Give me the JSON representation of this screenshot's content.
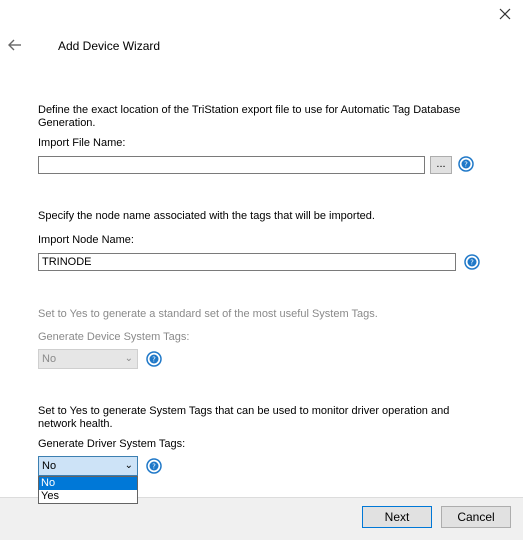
{
  "header": {
    "title": "Add Device Wizard"
  },
  "section_import_file": {
    "description": "Define the exact location of the TriStation export file to use for Automatic Tag Database Generation.",
    "label": "Import File Name:",
    "value": "",
    "browse_label": "..."
  },
  "section_node": {
    "description": "Specify the node name associated with the tags that will be imported.",
    "label": "Import Node Name:",
    "value": "TRINODE"
  },
  "section_device_tags": {
    "description": "Set to Yes to generate a standard set of the most useful System Tags.",
    "label": "Generate Device System Tags:",
    "value": "No"
  },
  "section_driver_tags": {
    "description": "Set to Yes to generate System Tags that can be used to monitor driver operation and network health.",
    "label": "Generate Driver System Tags:",
    "value": "No",
    "options": [
      "No",
      "Yes"
    ]
  },
  "footer": {
    "next_label": "Next",
    "cancel_label": "Cancel"
  },
  "colors": {
    "selected_option": "#0078d7",
    "help_icon": "#1f78c8"
  }
}
